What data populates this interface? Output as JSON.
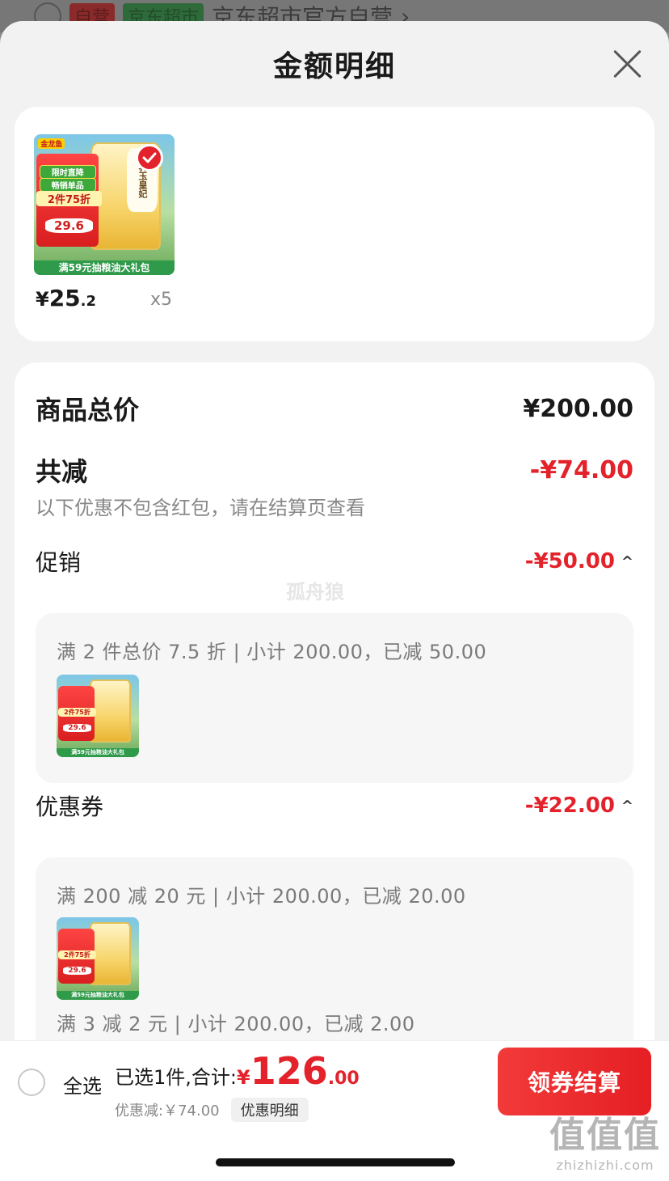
{
  "background_shop": {
    "tag1": "自营",
    "tag2": "京东超市",
    "name": "京东超市官方自营",
    "chevron": "›"
  },
  "sheet": {
    "title": "金额明细",
    "close_icon": "close-icon"
  },
  "product": {
    "brand": "金龙鱼",
    "bag_name": "乳玉皇妃",
    "promo_tag_1": "限时直降",
    "promo_tag_2": "畅销单品",
    "promo_discount": "2件75折",
    "promo_price": "29.6",
    "banner": "满59元抽粮油大礼包",
    "price_currency": "¥",
    "price_int": "25",
    "price_dec": ".2",
    "quantity": "x5",
    "selected": true
  },
  "summary": {
    "total_label": "商品总价",
    "total_value": "¥200.00",
    "reduce_label": "共减",
    "reduce_value": "-¥74.00",
    "note": "以下优惠不包含红包，请在结算页查看"
  },
  "promotion": {
    "label": "促销",
    "value": "-¥50.00",
    "caret": "^",
    "line": "满 2 件总价 7.5 折 | 小计 200.00，已减 50.00"
  },
  "coupons": {
    "label": "优惠券",
    "value": "-¥22.00",
    "caret": "^",
    "line1": "满 200 减 20 元 | 小计 200.00，已减 20.00",
    "line2": "满 3 减 2 元 | 小计 200.00，已减 2.00"
  },
  "watermark_center": "孤舟狼",
  "bottom_bar": {
    "select_all": "全选",
    "selected_label": "已选1件,合计:",
    "total_currency": "¥",
    "total_int": "126",
    "total_dec": ".00",
    "discount_text": "优惠减:￥74.00",
    "detail_chip": "优惠明细",
    "checkout_label": "领券结算"
  },
  "site_watermark": {
    "big": "值值值",
    "small": "zhizhizhi.com"
  },
  "colors": {
    "accent_red": "#e3222b",
    "sheet_bg": "#f2f2f2",
    "card_bg": "#ffffff"
  }
}
